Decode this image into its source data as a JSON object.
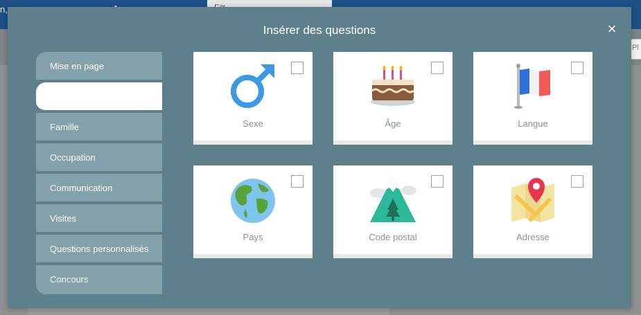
{
  "background": {
    "left_text": "n,",
    "filter_label": "Filt",
    "right_input": "Pl"
  },
  "modal": {
    "title": "Insérer des questions",
    "close_glyph": "×"
  },
  "sidebar": {
    "items": [
      {
        "label": "Mise en page",
        "active": false
      },
      {
        "label": "",
        "active": true
      },
      {
        "label": "Famille",
        "active": false
      },
      {
        "label": "Occupation",
        "active": false
      },
      {
        "label": "Communication",
        "active": false
      },
      {
        "label": "Visites",
        "active": false
      },
      {
        "label": "Questions personnalisés",
        "active": false
      },
      {
        "label": "Concours",
        "active": false
      }
    ]
  },
  "cards": [
    {
      "label": "Sexe",
      "icon": "male-gender-icon",
      "checked": false
    },
    {
      "label": "Âge",
      "icon": "birthday-cake-icon",
      "checked": false
    },
    {
      "label": "Langue",
      "icon": "french-flag-icon",
      "checked": false
    },
    {
      "label": "Pays",
      "icon": "globe-icon",
      "checked": false
    },
    {
      "label": "Code postal",
      "icon": "mountain-icon",
      "checked": false
    },
    {
      "label": "Adresse",
      "icon": "map-pin-icon",
      "checked": false
    }
  ],
  "colors": {
    "modal_bg": "#5e808c",
    "sidebar_item": "#83a1aa",
    "male_blue": "#3d9ae2",
    "pin_red": "#e8344e"
  }
}
